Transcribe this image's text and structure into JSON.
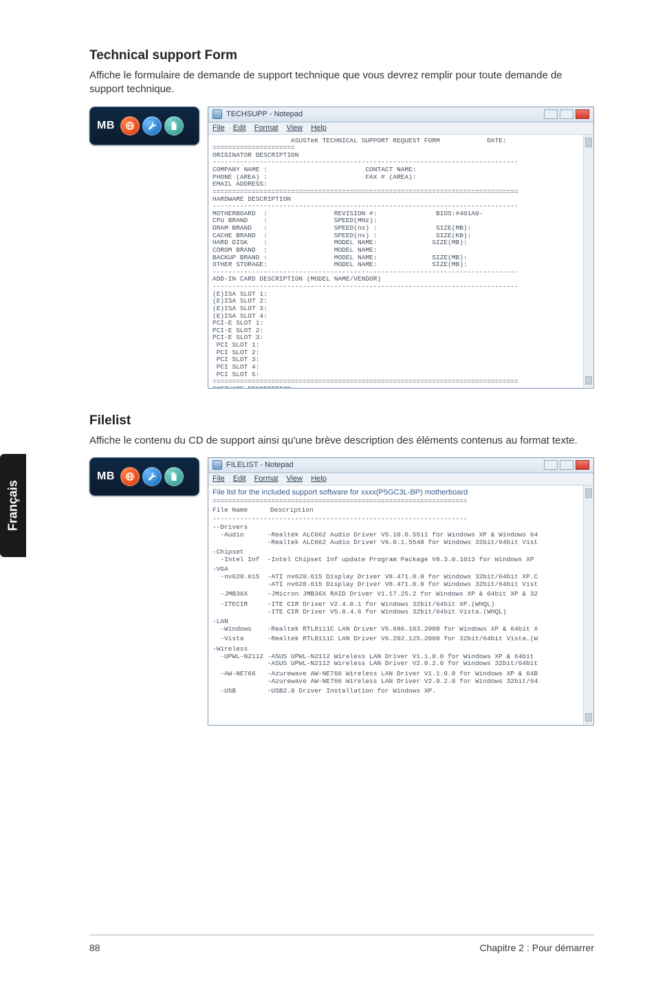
{
  "sideTab": "Français",
  "footer": {
    "pageNo": "88",
    "chapter": "Chapitre 2 : Pour démarrer"
  },
  "badge": {
    "text": "MB"
  },
  "section1": {
    "title": "Technical support Form",
    "desc": "Affiche le formulaire de demande de support technique que vous devrez remplir pour toute demande de support technique.",
    "windowTitle": "TECHSUPP - Notepad",
    "menu": {
      "file": "File",
      "edit": "Edit",
      "format": "Format",
      "view": "View",
      "help": "Help"
    },
    "head": {
      "title": "ASUSTeK TECHNICAL SUPPORT REQUEST FORM",
      "date": "DATE:"
    },
    "origLabel": "ORIGINATOR DESCRIPTION",
    "orig": {
      "company": "COMPANY NAME :",
      "phone": "PHONE (AREA) :",
      "email": "EMAIL ADDRESS:",
      "contact": "CONTACT NAME:",
      "fax": "FAX # (AREA):"
    },
    "hwLabel": "HARDWARE DESCRIPTION",
    "hw": {
      "mb": "MOTHERBOARD  :",
      "rev": "REVISION #:",
      "bios": "BIOS:#401A0-",
      "cpu": "CPU BRAND    :",
      "speed": "SPEED(MHz):",
      "dram": "DRAM BRAND   :",
      "dspeed": "SPEED(ns) :",
      "dsize": "SIZE(MB):",
      "cache": "CACHE BRAND  :",
      "cspeed": "SPEED(ns) :",
      "csize": "SIZE(KB):",
      "hdd": "HARD DISK    :",
      "hmodel": "MODEL NAME:",
      "hsize": "SIZE(MB):",
      "cdrom": "CDROM BRAND  :",
      "cmodel": "MODEL NAME:",
      "backup": "BACKUP BRAND :",
      "bmodel": "MODEL NAME:",
      "bsize": "SIZE(MB):",
      "other": "OTHER STORAGE:",
      "omodel": "MODEL NAME:",
      "osize": "SIZE(MB):"
    },
    "addinLabel": "ADD-IN CARD DESCRIPTION (MODEL NAME/VENDOR)",
    "slots": {
      "e1": "(E)ISA SLOT 1:",
      "e2": "(E)ISA SLOT 2:",
      "e3": "(E)ISA SLOT 3:",
      "e4": "(E)ISA SLOT 4:",
      "pe1": "PCI-E SLOT 1:",
      "pe2": "PCI-E SLOT 2:",
      "pe3": "PCI-E SLOT 3:",
      "p1": " PCI SLOT 1:",
      "p2": " PCI SLOT 2:",
      "p3": " PCI SLOT 3:",
      "p4": " PCI SLOT 4:",
      "p5": " PCI SLOT 5:"
    },
    "swLabel": "SOFTWARE DESCRIPTION"
  },
  "section2": {
    "title": "Filelist",
    "desc": "Affiche le contenu du CD de support ainsi qu'une brève description des éléments contenus au format texte.",
    "windowTitle": "FILELIST - Notepad",
    "menu": {
      "file": "File",
      "edit": "Edit",
      "format": "Format",
      "view": "View",
      "help": "Help"
    },
    "intro": "File list for the included support software for xxxx(P5GC3L-BP) motherboard",
    "cols": {
      "name": "File Name",
      "desc": "Description"
    },
    "items": [
      {
        "cat": "--Drivers",
        "name": "-Audio",
        "lines": [
          "-Realtek ALC662 Audio Driver V5.10.0.5511 for Windows XP & Windows 64",
          "-Realtek ALC662 Audio Driver V6.0.1.5548 for Windows 32bit/64bit Vist"
        ]
      },
      {
        "cat": "-Chipset",
        "name": "-Intel Inf",
        "lines": [
          "-Intel Chipset Inf update Program Package V8.3.0.1013 for Windows XP"
        ]
      },
      {
        "cat": "-VGA",
        "name": "-nv620.615",
        "lines": [
          "-ATI nv620.615 Display Driver V8.471.0.0 for Windows 32bit/64bit XP.C",
          "-ATI nv620.615 Display Driver V8.471.0.0 for Windows 32bit/64bit Vist"
        ]
      },
      {
        "cat": "",
        "name": "-JMB36X",
        "lines": [
          "-JMicron JMB36X RAID Driver V1.17.25.2 for Windows XP & 64bit XP & 32"
        ]
      },
      {
        "cat": "",
        "name": "-ITECIR",
        "lines": [
          "-ITE CIR Driver V2.4.0.1 for Windows 32bit/64bit XP.(WHQL)",
          "-ITE CIR Driver V5.0.4.6 for Windows 32bit/64bit Vista.(WHQL)"
        ]
      },
      {
        "cat": "-LAN",
        "name": "-Windows",
        "lines": [
          "-Realtek RTL8111C LAN Driver V5.686.103.2008 for Windows XP & 64bit X"
        ]
      },
      {
        "cat": "",
        "name": "-Vista",
        "lines": [
          "-Realtek RTL8111C LAN Driver V6.202.125.2008 for 32bit/64bit Vista.(W"
        ]
      },
      {
        "cat": "-Wireless",
        "name": "-UPWL-N2112",
        "lines": [
          "-ASUS UPWL-N2112 Wireless LAN Driver V1.1.0.0 for Windows XP & 64bit",
          "-ASUS UPWL-N2112 Wireless LAN Driver V2.0.2.0 for Windows 32bit/64bit"
        ]
      },
      {
        "cat": "",
        "name": "-AW-NE766",
        "lines": [
          "-Azurewave AW-NE766 Wireless LAN Driver V1.1.0.0 for Windows XP & 64B",
          "-Azurewave AW-NE766 Wireless LAN Driver V2.0.2.0 for Windows 32bit/64"
        ]
      },
      {
        "cat": "",
        "name": "-USB",
        "lines": [
          "-USB2.0 Driver Installation for Windows XP."
        ]
      }
    ]
  }
}
